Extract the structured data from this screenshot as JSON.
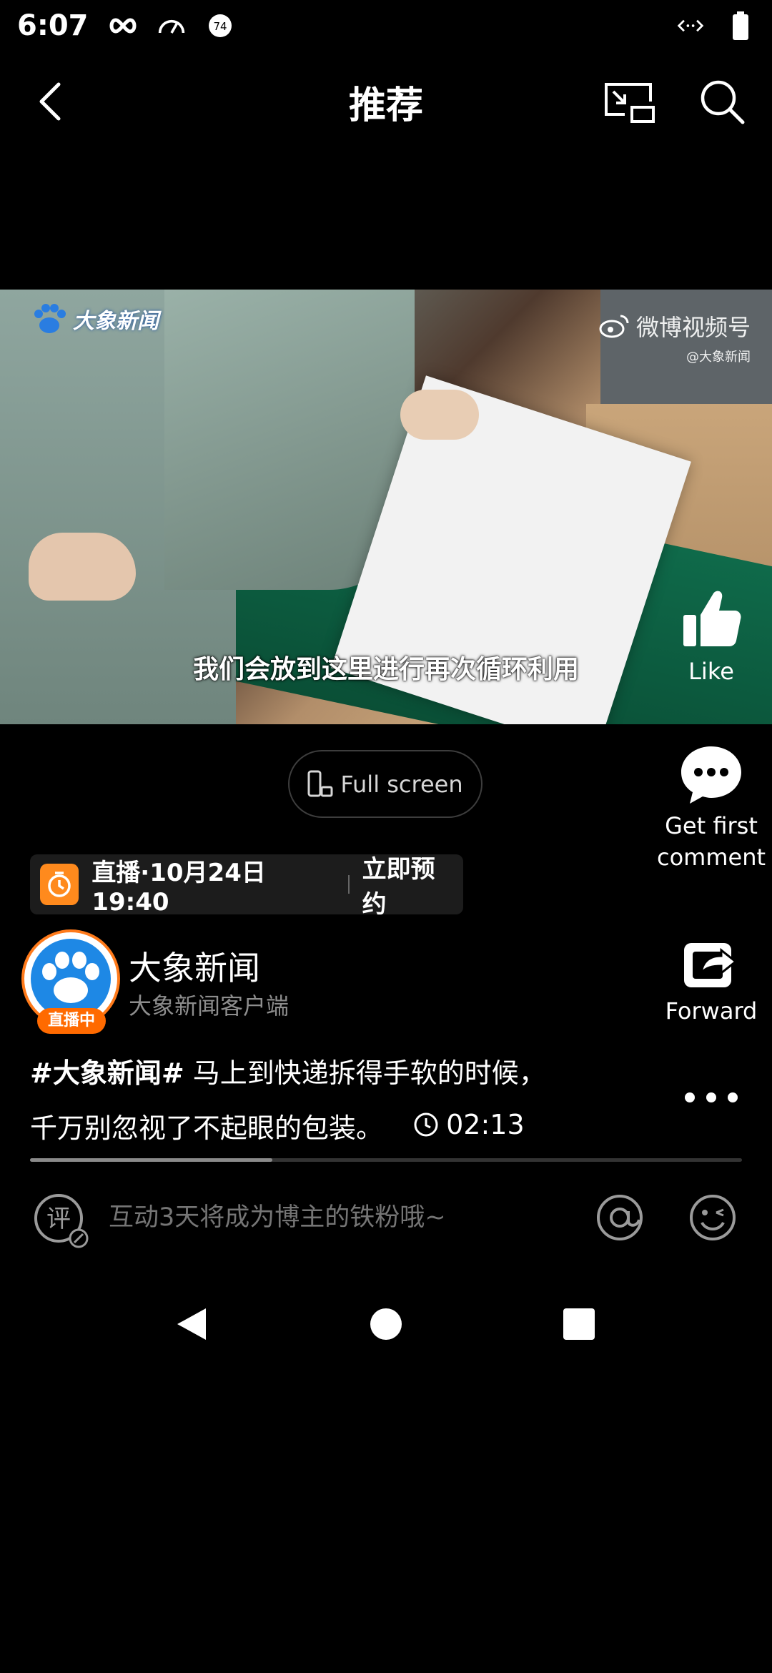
{
  "status_bar": {
    "time": "6:07",
    "badge_number": "74"
  },
  "header": {
    "title": "推荐"
  },
  "video": {
    "logo_text": "大象新闻",
    "watermark_main": "微博视频号",
    "watermark_sub": "@大象新闻",
    "subtitle": "我们会放到这里进行再次循环利用"
  },
  "actions": {
    "like_label": "Like",
    "comment_label_line1": "Get first",
    "comment_label_line2": "comment",
    "forward_label": "Forward"
  },
  "fullscreen_label": "Full screen",
  "live_banner": {
    "text": "直播·10月24日 19:40",
    "reserve_label": "立即预约"
  },
  "author": {
    "name": "大象新闻",
    "subtitle": "大象新闻客户端",
    "live_badge": "直播中"
  },
  "caption": {
    "tag": "#大象新闻#",
    "text_line1": " 马上到快递拆得手软的时候，",
    "text_line2": "千万别忽视了不起眼的包装。",
    "duration": "02:13"
  },
  "progress": {
    "fraction": 0.34
  },
  "comment_bar": {
    "placeholder": "互动3天将成为博主的铁粉哦~",
    "comment_icon_char": "评"
  },
  "icons": {
    "status": [
      "infinity-icon",
      "speedometer-icon",
      "badge-icon",
      "code-icon",
      "battery-icon"
    ],
    "header": [
      "back-icon",
      "pip-icon",
      "search-icon"
    ]
  },
  "colors": {
    "accent_orange": "#ff7a1a",
    "background": "#000000"
  }
}
